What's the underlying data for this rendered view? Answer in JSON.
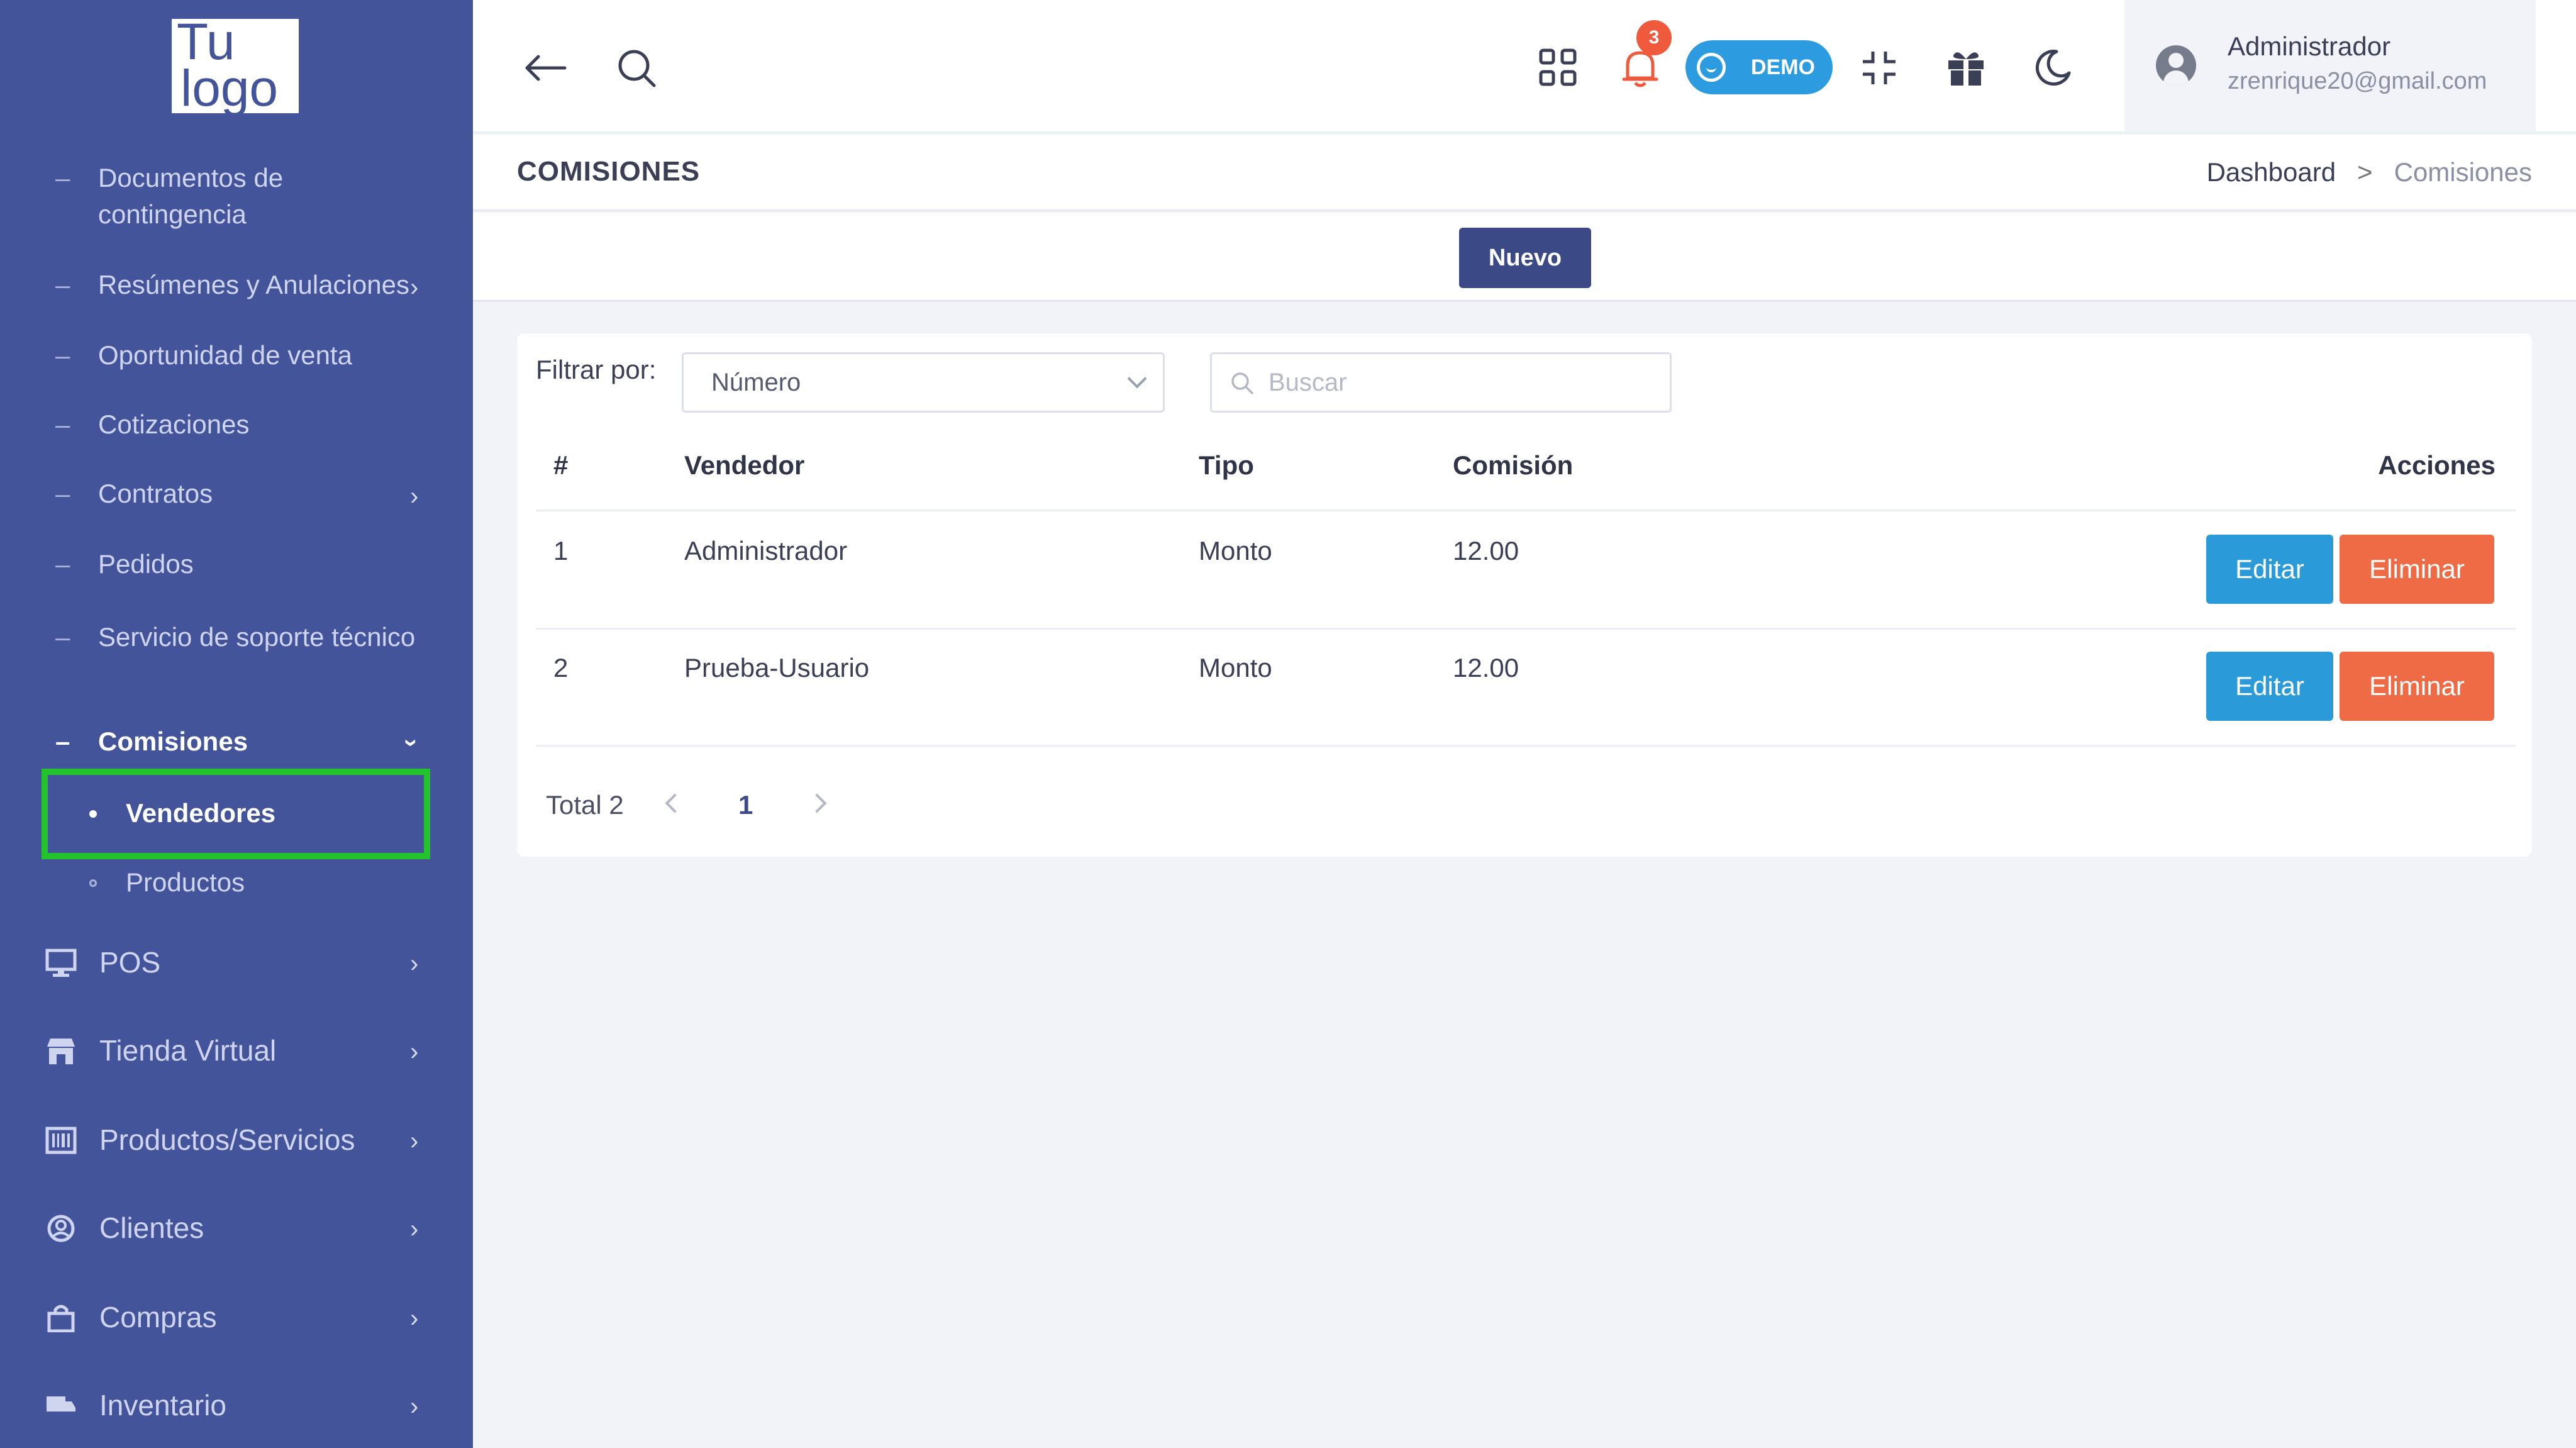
{
  "sidebar": {
    "logo_line1": "Tu",
    "logo_line2": "logo",
    "sub_items": [
      {
        "label": "Documentos de contingencia"
      },
      {
        "label": "Resúmenes y Anulaciones"
      },
      {
        "label": "Oportunidad de venta"
      },
      {
        "label": "Cotizaciones"
      },
      {
        "label": "Contratos"
      },
      {
        "label": "Pedidos"
      },
      {
        "label": "Servicio de soporte técnico"
      },
      {
        "label": "Comisiones"
      }
    ],
    "comisiones_children": [
      {
        "label": "Vendedores"
      },
      {
        "label": "Productos"
      }
    ],
    "main_items": [
      {
        "label": "POS",
        "icon": "monitor-icon"
      },
      {
        "label": "Tienda Virtual",
        "icon": "store-icon"
      },
      {
        "label": "Productos/Servicios",
        "icon": "barcode-icon"
      },
      {
        "label": "Clientes",
        "icon": "user-circle-icon"
      },
      {
        "label": "Compras",
        "icon": "shopping-bag-icon"
      },
      {
        "label": "Inventario",
        "icon": "truck-icon"
      }
    ]
  },
  "topbar": {
    "notification_count": "3",
    "demo_label": "DEMO",
    "user_name": "Administrador",
    "user_email": "zrenrique20@gmail.com"
  },
  "header": {
    "title": "COMISIONES",
    "breadcrumb_home": "Dashboard",
    "breadcrumb_sep": ">",
    "breadcrumb_current": "Comisiones"
  },
  "actions": {
    "new_label": "Nuevo"
  },
  "filter": {
    "label": "Filtrar por:",
    "selected": "Número",
    "search_placeholder": "Buscar"
  },
  "table": {
    "headers": {
      "num": "#",
      "vendedor": "Vendedor",
      "tipo": "Tipo",
      "comision": "Comisión",
      "acciones": "Acciones"
    },
    "rows": [
      {
        "num": "1",
        "vendedor": "Administrador",
        "tipo": "Monto",
        "comision": "12.00"
      },
      {
        "num": "2",
        "vendedor": "Prueba-Usuario",
        "tipo": "Monto",
        "comision": "12.00"
      }
    ],
    "edit_label": "Editar",
    "delete_label": "Eliminar"
  },
  "pagination": {
    "total_label": "Total 2",
    "current_page": "1"
  },
  "colors": {
    "sidebar_bg": "#44549b",
    "primary_button": "#3b4a86",
    "edit_button": "#2b9ad9",
    "delete_button": "#ef6b45",
    "demo_pill": "#2d9be0",
    "notification_badge": "#ef5a3c",
    "highlight_border": "#22c32b"
  }
}
